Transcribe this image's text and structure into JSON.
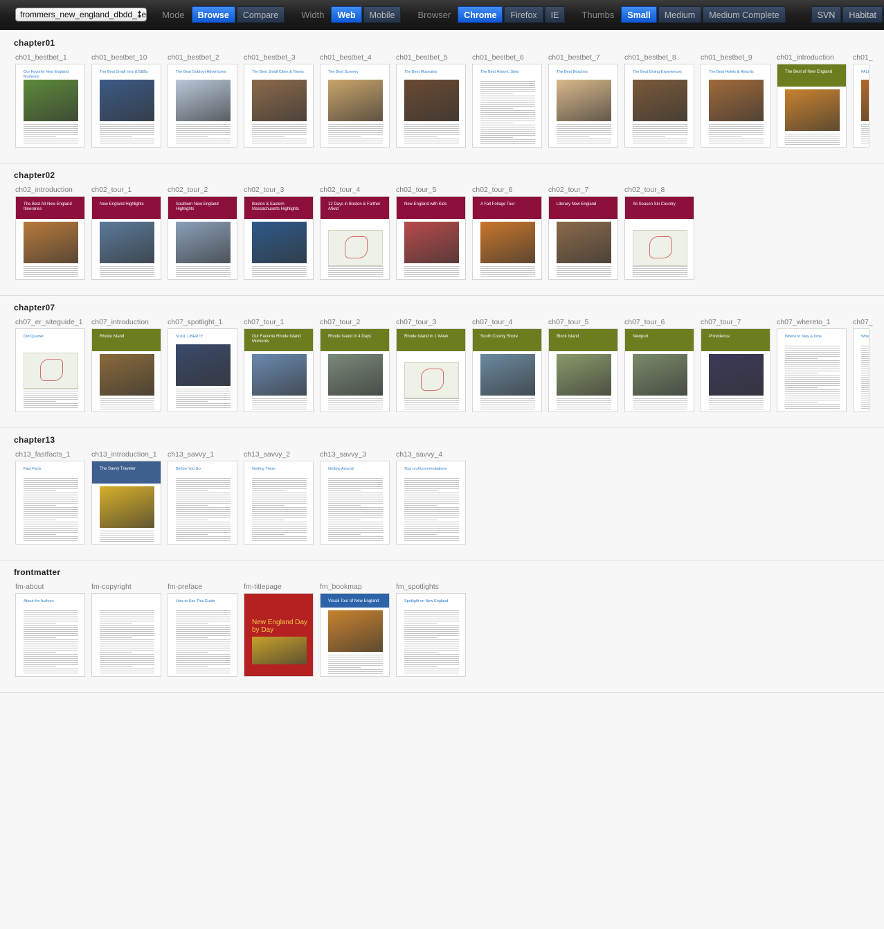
{
  "toolbar": {
    "book_select": "frommers_new_england_dbdd_1e",
    "mode_label": "Mode",
    "mode_options": [
      {
        "label": "Browse",
        "active": true
      },
      {
        "label": "Compare",
        "active": false
      }
    ],
    "width_label": "Width",
    "width_options": [
      {
        "label": "Web",
        "active": true
      },
      {
        "label": "Mobile",
        "active": false
      }
    ],
    "browser_label": "Browser",
    "browser_options": [
      {
        "label": "Chrome",
        "active": true
      },
      {
        "label": "Firefox",
        "active": false
      },
      {
        "label": "IE",
        "active": false
      }
    ],
    "thumbs_label": "Thumbs",
    "thumbs_options": [
      {
        "label": "Small",
        "active": true
      },
      {
        "label": "Medium",
        "active": false
      },
      {
        "label": "Medium Complete",
        "active": false
      }
    ],
    "right_buttons": [
      "SVN",
      "Habitat"
    ]
  },
  "sections": [
    {
      "title": "chapter01",
      "pages": [
        {
          "label": "ch01_bestbet_1",
          "heading": "Our Favorite New England Moments",
          "style": "white",
          "photo": "#5d8a3a"
        },
        {
          "label": "ch01_bestbet_10",
          "heading": "The Best Small Inns & B&Bs",
          "style": "white",
          "photo": "#3b5a86"
        },
        {
          "label": "ch01_bestbet_2",
          "heading": "The Best Outdoor Adventures",
          "style": "white",
          "photo": "#b8c8d8"
        },
        {
          "label": "ch01_bestbet_3",
          "heading": "The Best Small Cities & Towns",
          "style": "white",
          "photo": "#8b6a4a"
        },
        {
          "label": "ch01_bestbet_4",
          "heading": "The Best Scenery",
          "style": "white",
          "photo": "#c9a46a"
        },
        {
          "label": "ch01_bestbet_5",
          "heading": "The Best Museums",
          "style": "white",
          "photo": "#6a4a32"
        },
        {
          "label": "ch01_bestbet_6",
          "heading": "The Best Historic Sites",
          "style": "white",
          "photo": "#ffffff"
        },
        {
          "label": "ch01_bestbet_7",
          "heading": "The Best Beaches",
          "style": "white",
          "photo": "#d8b88a"
        },
        {
          "label": "ch01_bestbet_8",
          "heading": "The Best Dining Experiences",
          "style": "white",
          "photo": "#7a5a3a"
        },
        {
          "label": "ch01_bestbet_9",
          "heading": "The Best Hotels & Resorts",
          "style": "white",
          "photo": "#a06a3a"
        },
        {
          "label": "ch01_introduction",
          "heading": "The Best of New England",
          "style": "olive",
          "photo": "#c8822e"
        },
        {
          "label": "ch01_",
          "heading": "FALL",
          "style": "white",
          "photo": "#b06a2a"
        }
      ]
    },
    {
      "title": "chapter02",
      "pages": [
        {
          "label": "ch02_introduction",
          "heading": "The Best All-New England Itineraries",
          "style": "maroon",
          "photo": "#b87a3a"
        },
        {
          "label": "ch02_tour_1",
          "heading": "New England Highlights",
          "style": "maroon",
          "photo": "#5a7a9a"
        },
        {
          "label": "ch02_tour_2",
          "heading": "Southern New England Highlights",
          "style": "maroon",
          "photo": "#8aa0b8"
        },
        {
          "label": "ch02_tour_3",
          "heading": "Boston & Eastern Massachusetts Highlights",
          "style": "maroon",
          "photo": "#2d5a8a"
        },
        {
          "label": "ch02_tour_4",
          "heading": "12 Days in Boston & Farther Afield",
          "style": "maroon",
          "photo": "map"
        },
        {
          "label": "ch02_tour_5",
          "heading": "New England with Kids",
          "style": "maroon",
          "photo": "#b84a4a"
        },
        {
          "label": "ch02_tour_6",
          "heading": "A Fall Foliage Tour",
          "style": "maroon",
          "photo": "#c8762a"
        },
        {
          "label": "ch02_tour_7",
          "heading": "Literary New England",
          "style": "maroon",
          "photo": "#8a6a4a"
        },
        {
          "label": "ch02_tour_8",
          "heading": "All-Season Ski Country",
          "style": "maroon",
          "photo": "map"
        }
      ]
    },
    {
      "title": "chapter07",
      "pages": [
        {
          "label": "ch07_er_siteguide_1",
          "heading": "Old Quarter",
          "style": "white",
          "photo": "map"
        },
        {
          "label": "ch07_introduction",
          "heading": "Rhode Island",
          "style": "olive",
          "photo": "#8a6a3a"
        },
        {
          "label": "ch07_spotlight_1",
          "heading": "SOUL LIBERTY",
          "style": "white",
          "photo": "#3a4a6a"
        },
        {
          "label": "ch07_tour_1",
          "heading": "Our Favorite Rhode Island Moments",
          "style": "olive",
          "photo": "#6a8ab0"
        },
        {
          "label": "ch07_tour_2",
          "heading": "Rhode Island in 4 Days",
          "style": "olive",
          "photo": "#7a8a7a"
        },
        {
          "label": "ch07_tour_3",
          "heading": "Rhode Island in 1 Week",
          "style": "olive",
          "photo": "map"
        },
        {
          "label": "ch07_tour_4",
          "heading": "South County Shore",
          "style": "olive",
          "photo": "#6a8aa0"
        },
        {
          "label": "ch07_tour_5",
          "heading": "Block Island",
          "style": "olive",
          "photo": "#8a9a6a"
        },
        {
          "label": "ch07_tour_6",
          "heading": "Newport",
          "style": "olive",
          "photo": "#7a8a6a"
        },
        {
          "label": "ch07_tour_7",
          "heading": "Providence",
          "style": "olive",
          "photo": "#3a3a5a"
        },
        {
          "label": "ch07_whereto_1",
          "heading": "Where to Stay & Dine",
          "style": "white",
          "photo": "#ffffff"
        },
        {
          "label": "ch07_",
          "heading": "Whe",
          "style": "white",
          "photo": "#ffffff"
        }
      ]
    },
    {
      "title": "chapter13",
      "pages": [
        {
          "label": "ch13_fastfacts_1",
          "heading": "Fast Facts",
          "style": "white",
          "photo": "#ffffff"
        },
        {
          "label": "ch13_introduction_1",
          "heading": "The Savvy Traveler",
          "style": "slate",
          "photo": "#d8b02a"
        },
        {
          "label": "ch13_savvy_1",
          "heading": "Before You Go",
          "style": "white",
          "photo": "#ffffff"
        },
        {
          "label": "ch13_savvy_2",
          "heading": "Getting There",
          "style": "white",
          "photo": "#ffffff"
        },
        {
          "label": "ch13_savvy_3",
          "heading": "Getting Around",
          "style": "white",
          "photo": "#ffffff"
        },
        {
          "label": "ch13_savvy_4",
          "heading": "Tips on Accommodations",
          "style": "white",
          "photo": "#ffffff"
        }
      ]
    },
    {
      "title": "frontmatter",
      "pages": [
        {
          "label": "fm-about",
          "heading": "About the Authors",
          "style": "white",
          "photo": "#ffffff"
        },
        {
          "label": "fm-copyright",
          "heading": "",
          "style": "white",
          "photo": "#ffffff"
        },
        {
          "label": "fm-preface",
          "heading": "How to Use This Guide",
          "style": "white",
          "photo": "#ffffff"
        },
        {
          "label": "fm-titlepage",
          "heading": "New England Day by Day",
          "style": "red",
          "photo": "#c8a02a"
        },
        {
          "label": "fm_bookmap",
          "heading": "Visual Tour of New England",
          "style": "blue",
          "photo": "#c8822e"
        },
        {
          "label": "fm_spotlights",
          "heading": "Spotlight on New England",
          "style": "white",
          "photo": "#ffffff"
        }
      ]
    }
  ],
  "colors": {
    "active_button": "#1565d8",
    "inactive_button": "#2c3c55",
    "maroon": "#8c0f3c",
    "olive": "#6b7d1f",
    "slate": "#3f5f8f",
    "red": "#b52020",
    "blue": "#2d63a8"
  }
}
